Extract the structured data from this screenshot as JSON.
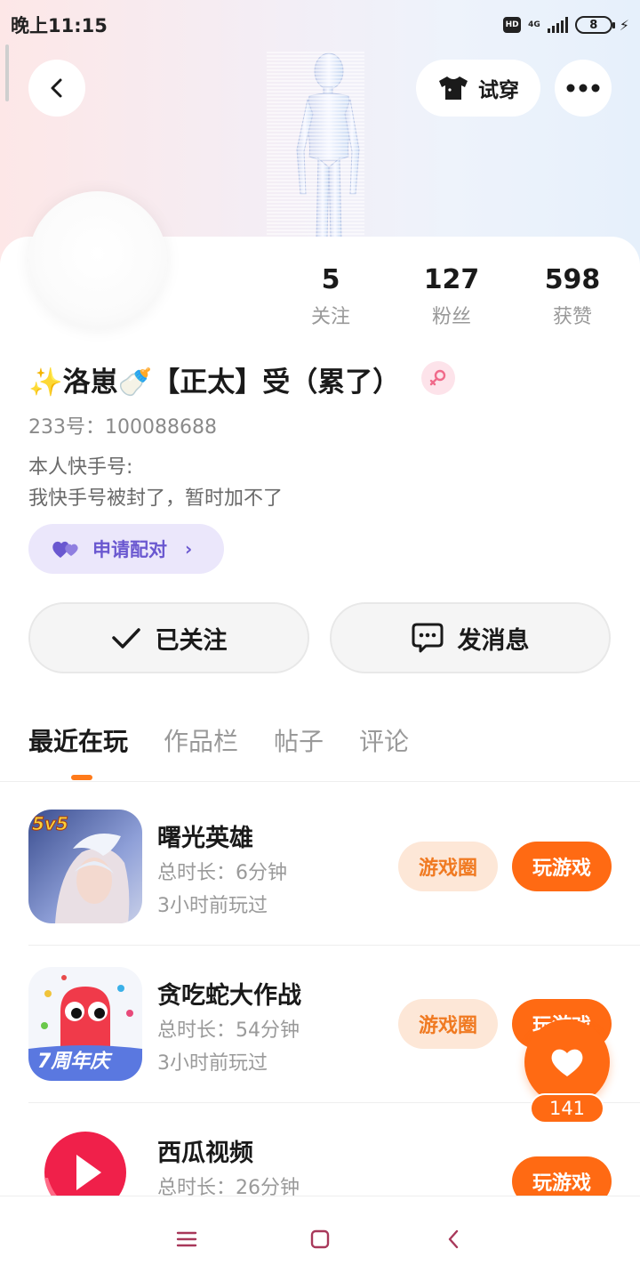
{
  "status_bar": {
    "time": "晚上11:15",
    "hd_label": "HD",
    "network_label": "4G",
    "battery_level": "8"
  },
  "header": {
    "try_on_label": "试穿"
  },
  "profile": {
    "stats": [
      {
        "value": "5",
        "label": "关注"
      },
      {
        "value": "127",
        "label": "粉丝"
      },
      {
        "value": "598",
        "label": "获赞"
      }
    ],
    "nickname": "✨洛崽🍼【正太】受（累了）",
    "uid": "233号：100088688",
    "bio_line1": "本人快手号:",
    "bio_line2": "我快手号被封了，暂时加不了",
    "pair_label": "申请配对",
    "follow_label": "已关注",
    "message_label": "发消息"
  },
  "tabs": [
    {
      "label": "最近在玩",
      "active": true
    },
    {
      "label": "作品栏",
      "active": false
    },
    {
      "label": "帖子",
      "active": false
    },
    {
      "label": "评论",
      "active": false
    }
  ],
  "games": [
    {
      "name": "曙光英雄",
      "duration": "总时长：6分钟",
      "last_played": "3小时前玩过",
      "circle_label": "游戏圈",
      "play_label": "玩游戏",
      "icon": "hero-game-icon",
      "icon_badge": "5v5"
    },
    {
      "name": "贪吃蛇大作战",
      "duration": "总时长：54分钟",
      "last_played": "3小时前玩过",
      "circle_label": "游戏圈",
      "play_label": "玩游戏",
      "icon": "snake-game-icon",
      "icon_badge": "7周年庆"
    },
    {
      "name": "西瓜视频",
      "duration": "总时长：26分钟",
      "last_played": "",
      "circle_label": "",
      "play_label": "玩游戏",
      "icon": "xigua-video-icon"
    }
  ],
  "like_fab": {
    "count": "141"
  },
  "colors": {
    "accent": "#ff6a13",
    "accent_light": "#fde7d7",
    "pair_bg": "#ebe7fb",
    "pair_text": "#6a58d0"
  }
}
